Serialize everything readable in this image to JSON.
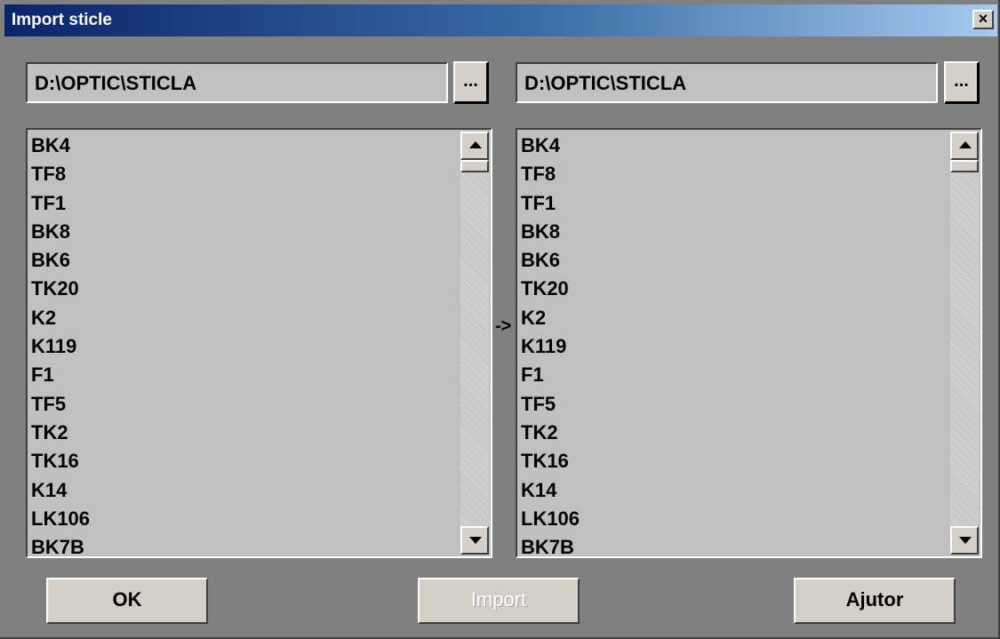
{
  "window": {
    "title": "Import sticle",
    "close_label": "×"
  },
  "left_panel": {
    "path": "D:\\OPTIC\\STICLA",
    "browse_label": "...",
    "items": [
      "BK4",
      "TF8",
      "TF1",
      "BK8",
      "BK6",
      "TK20",
      "K2",
      "K119",
      "F1",
      "TF5",
      "TK2",
      "TK16",
      "K14",
      "LK106",
      "BK7B"
    ]
  },
  "right_panel": {
    "path": "D:\\OPTIC\\STICLA",
    "browse_label": "...",
    "items": [
      "BK4",
      "TF8",
      "TF1",
      "BK8",
      "BK6",
      "TK20",
      "K2",
      "K119",
      "F1",
      "TF5",
      "TK2",
      "TK16",
      "K14",
      "LK106",
      "BK7B"
    ]
  },
  "arrow_label": "->",
  "buttons": {
    "ok_label": "OK",
    "import_label": "Import",
    "help_label": "Ajutor"
  }
}
